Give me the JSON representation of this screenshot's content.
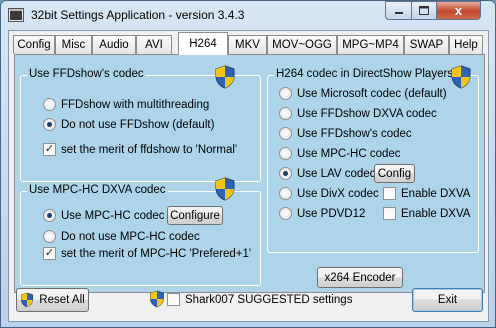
{
  "window": {
    "title": "32bit Settings Application - version 3.4.3",
    "close_glyph": "x"
  },
  "tabs": [
    {
      "label": "Config"
    },
    {
      "label": "Misc"
    },
    {
      "label": "Audio"
    },
    {
      "label": "AVI"
    },
    {
      "label": "H264",
      "active": true
    },
    {
      "label": "MKV"
    },
    {
      "label": "MOV~OGG"
    },
    {
      "label": "MPG~MP4"
    },
    {
      "label": "SWAP"
    },
    {
      "label": "Help"
    }
  ],
  "ffdshow_group": {
    "title": "Use FFDshow's codec",
    "options": [
      {
        "label": "FFDshow with multithreading",
        "selected": false
      },
      {
        "label": "Do not use FFDshow (default)",
        "selected": true
      }
    ],
    "merit_checkbox": {
      "label": "set the merit of ffdshow to 'Normal'",
      "checked": true
    }
  },
  "mpchc_group": {
    "title": "Use MPC-HC DXVA codec",
    "options": [
      {
        "label": "Use MPC-HC codec",
        "selected": true
      },
      {
        "label": "Do not use MPC-HC codec",
        "selected": false
      }
    ],
    "configure_button": "Configure",
    "merit_checkbox": {
      "label": "set the merit of MPC-HC 'Prefered+1'",
      "checked": true
    }
  },
  "h264_group": {
    "title": "H264 codec in DirectShow Players",
    "options": [
      {
        "label": "Use Microsoft codec (default)",
        "selected": false
      },
      {
        "label": "Use FFDshow DXVA codec",
        "selected": false
      },
      {
        "label": "Use FFDshow's codec",
        "selected": false
      },
      {
        "label": "Use MPC-HC codec",
        "selected": false
      },
      {
        "label": "Use LAV codec",
        "selected": true
      },
      {
        "label": "Use DivX codec",
        "selected": false
      },
      {
        "label": "Use PDVD12",
        "selected": false
      }
    ],
    "config_button": "Config",
    "divx_dxva": {
      "label": "Enable DXVA",
      "checked": false
    },
    "pdvd_dxva": {
      "label": "Enable DXVA",
      "checked": false
    },
    "encoder_button": "x264 Encoder"
  },
  "footer": {
    "reset_button": "Reset All",
    "suggested_checkbox": {
      "label": "Shark007 SUGGESTED settings",
      "checked": false
    },
    "exit_button": "Exit"
  },
  "colors": {
    "panel": "#add4e9",
    "shield_blue": "#2f63b5",
    "shield_yellow": "#f2c416"
  }
}
